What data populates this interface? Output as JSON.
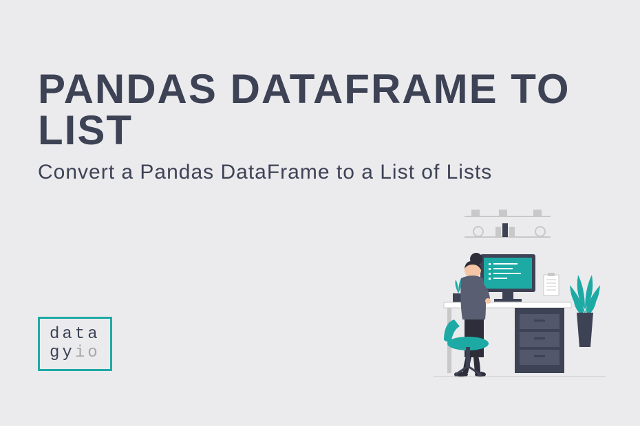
{
  "title": "PANDAS DATAFRAME TO LIST",
  "subtitle": "Convert a Pandas DataFrame to a List of Lists",
  "logo": {
    "line1": "data",
    "line2_left": "gy",
    "line2_right": "io"
  }
}
